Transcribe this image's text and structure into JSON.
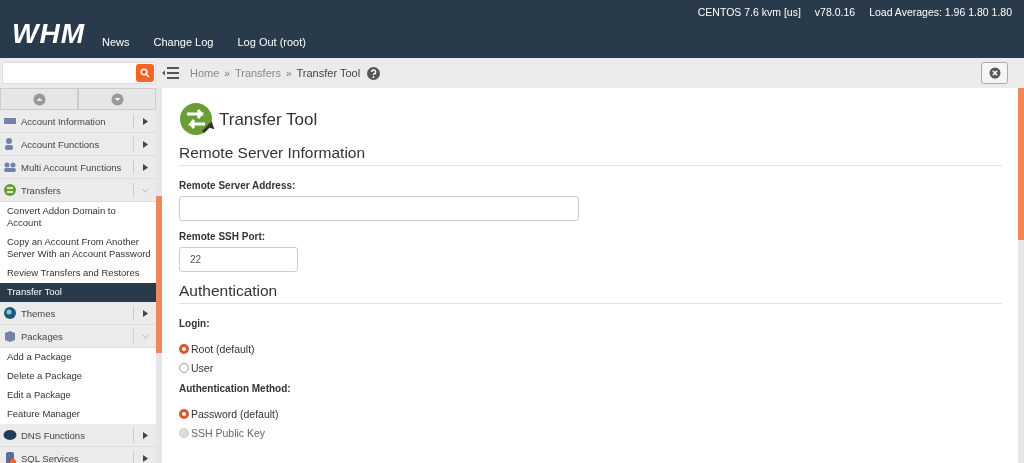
{
  "topbar": {
    "logo": "WHM",
    "nav": [
      "News",
      "Change Log",
      "Log Out (root)"
    ],
    "info": [
      "CENTOS 7.6 kvm [us]",
      "v78.0.16",
      "Load Averages: 1.96 1.80 1.80"
    ]
  },
  "breadcrumb": {
    "separator": "»",
    "items": [
      {
        "label": "Home",
        "current": false
      },
      {
        "label": "Transfers",
        "current": false
      },
      {
        "label": "Transfer Tool",
        "current": true
      }
    ]
  },
  "sidebar": {
    "categories": [
      {
        "label": "Account Information",
        "expanded": false
      },
      {
        "label": "Account Functions",
        "expanded": false
      },
      {
        "label": "Multi Account Functions",
        "expanded": false
      },
      {
        "label": "Transfers",
        "expanded": true,
        "children": [
          {
            "label": "Convert Addon Domain to Account",
            "selected": false
          },
          {
            "label": "Copy an Account From Another Server With an Account Password",
            "selected": false
          },
          {
            "label": "Review Transfers and Restores",
            "selected": false
          },
          {
            "label": "Transfer Tool",
            "selected": true
          }
        ]
      },
      {
        "label": "Themes",
        "expanded": false
      },
      {
        "label": "Packages",
        "expanded": true,
        "children": [
          {
            "label": "Add a Package",
            "selected": false
          },
          {
            "label": "Delete a Package",
            "selected": false
          },
          {
            "label": "Edit a Package",
            "selected": false
          },
          {
            "label": "Feature Manager",
            "selected": false
          }
        ]
      },
      {
        "label": "DNS Functions",
        "expanded": false
      },
      {
        "label": "SQL Services",
        "expanded": false
      }
    ]
  },
  "page": {
    "title": "Transfer Tool",
    "sections": [
      {
        "heading": "Remote Server Information",
        "fields": [
          {
            "kind": "text",
            "label": "Remote Server Address:"
          },
          {
            "kind": "port",
            "label": "Remote SSH Port:",
            "value": "22"
          }
        ]
      },
      {
        "heading": "Authentication",
        "fields": [
          {
            "kind": "radio",
            "label": "Login:",
            "options": [
              {
                "label": "Root (default)",
                "selected": true,
                "disabled": false
              },
              {
                "label": "User",
                "selected": false,
                "disabled": false
              }
            ]
          },
          {
            "kind": "radio",
            "label": "Authentication Method:",
            "options": [
              {
                "label": "Password (default)",
                "selected": true,
                "disabled": false
              },
              {
                "label": "SSH Public Key",
                "selected": false,
                "disabled": true
              }
            ]
          }
        ]
      }
    ]
  }
}
